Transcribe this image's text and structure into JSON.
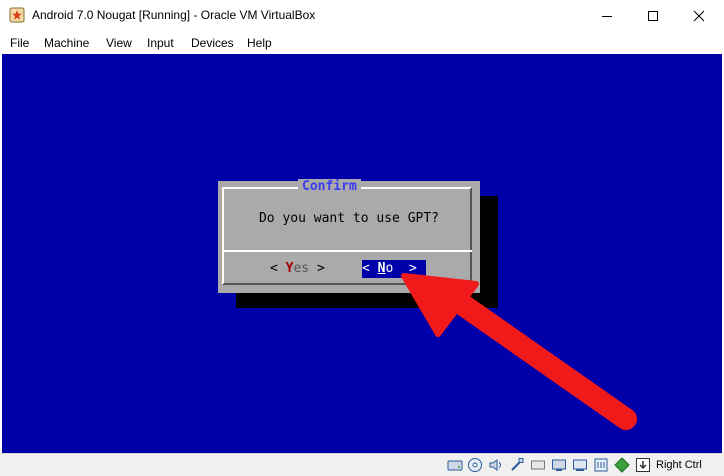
{
  "window": {
    "title": "Android 7.0 Nougat [Running] - Oracle VM VirtualBox",
    "controls": [
      "minimize-icon",
      "maximize-icon",
      "close-icon"
    ]
  },
  "menu": {
    "items": [
      "File",
      "Machine",
      "View",
      "Input",
      "Devices",
      "Help"
    ]
  },
  "dialog": {
    "title": "Confirm",
    "message": "Do you want to use GPT?",
    "yes": {
      "left": "< ",
      "hotkey": "Y",
      "rest": "es",
      "right": " >"
    },
    "no": {
      "left": "< ",
      "hotkey": "N",
      "rest": "o",
      "right": "  >",
      "selected": true
    }
  },
  "statusbar": {
    "icons": [
      "hard-disk-icon",
      "optical-drive-icon",
      "audio-icon",
      "network-icon",
      "usb-icon",
      "shared-folders-icon",
      "display-icon",
      "recording-icon",
      "cpu-icon",
      "guest-additions-icon",
      "mouse-integration-icon"
    ],
    "host_key": "Right Ctrl"
  },
  "colors": {
    "vm_background": "#0000aa",
    "dialog_background": "#aaaaaa",
    "dialog_title": "#3a3af0",
    "hotkey_yes": "#aa0000",
    "annotation_arrow": "#f01a1a"
  },
  "annotation": {
    "type": "arrow",
    "points_to": "No button"
  }
}
